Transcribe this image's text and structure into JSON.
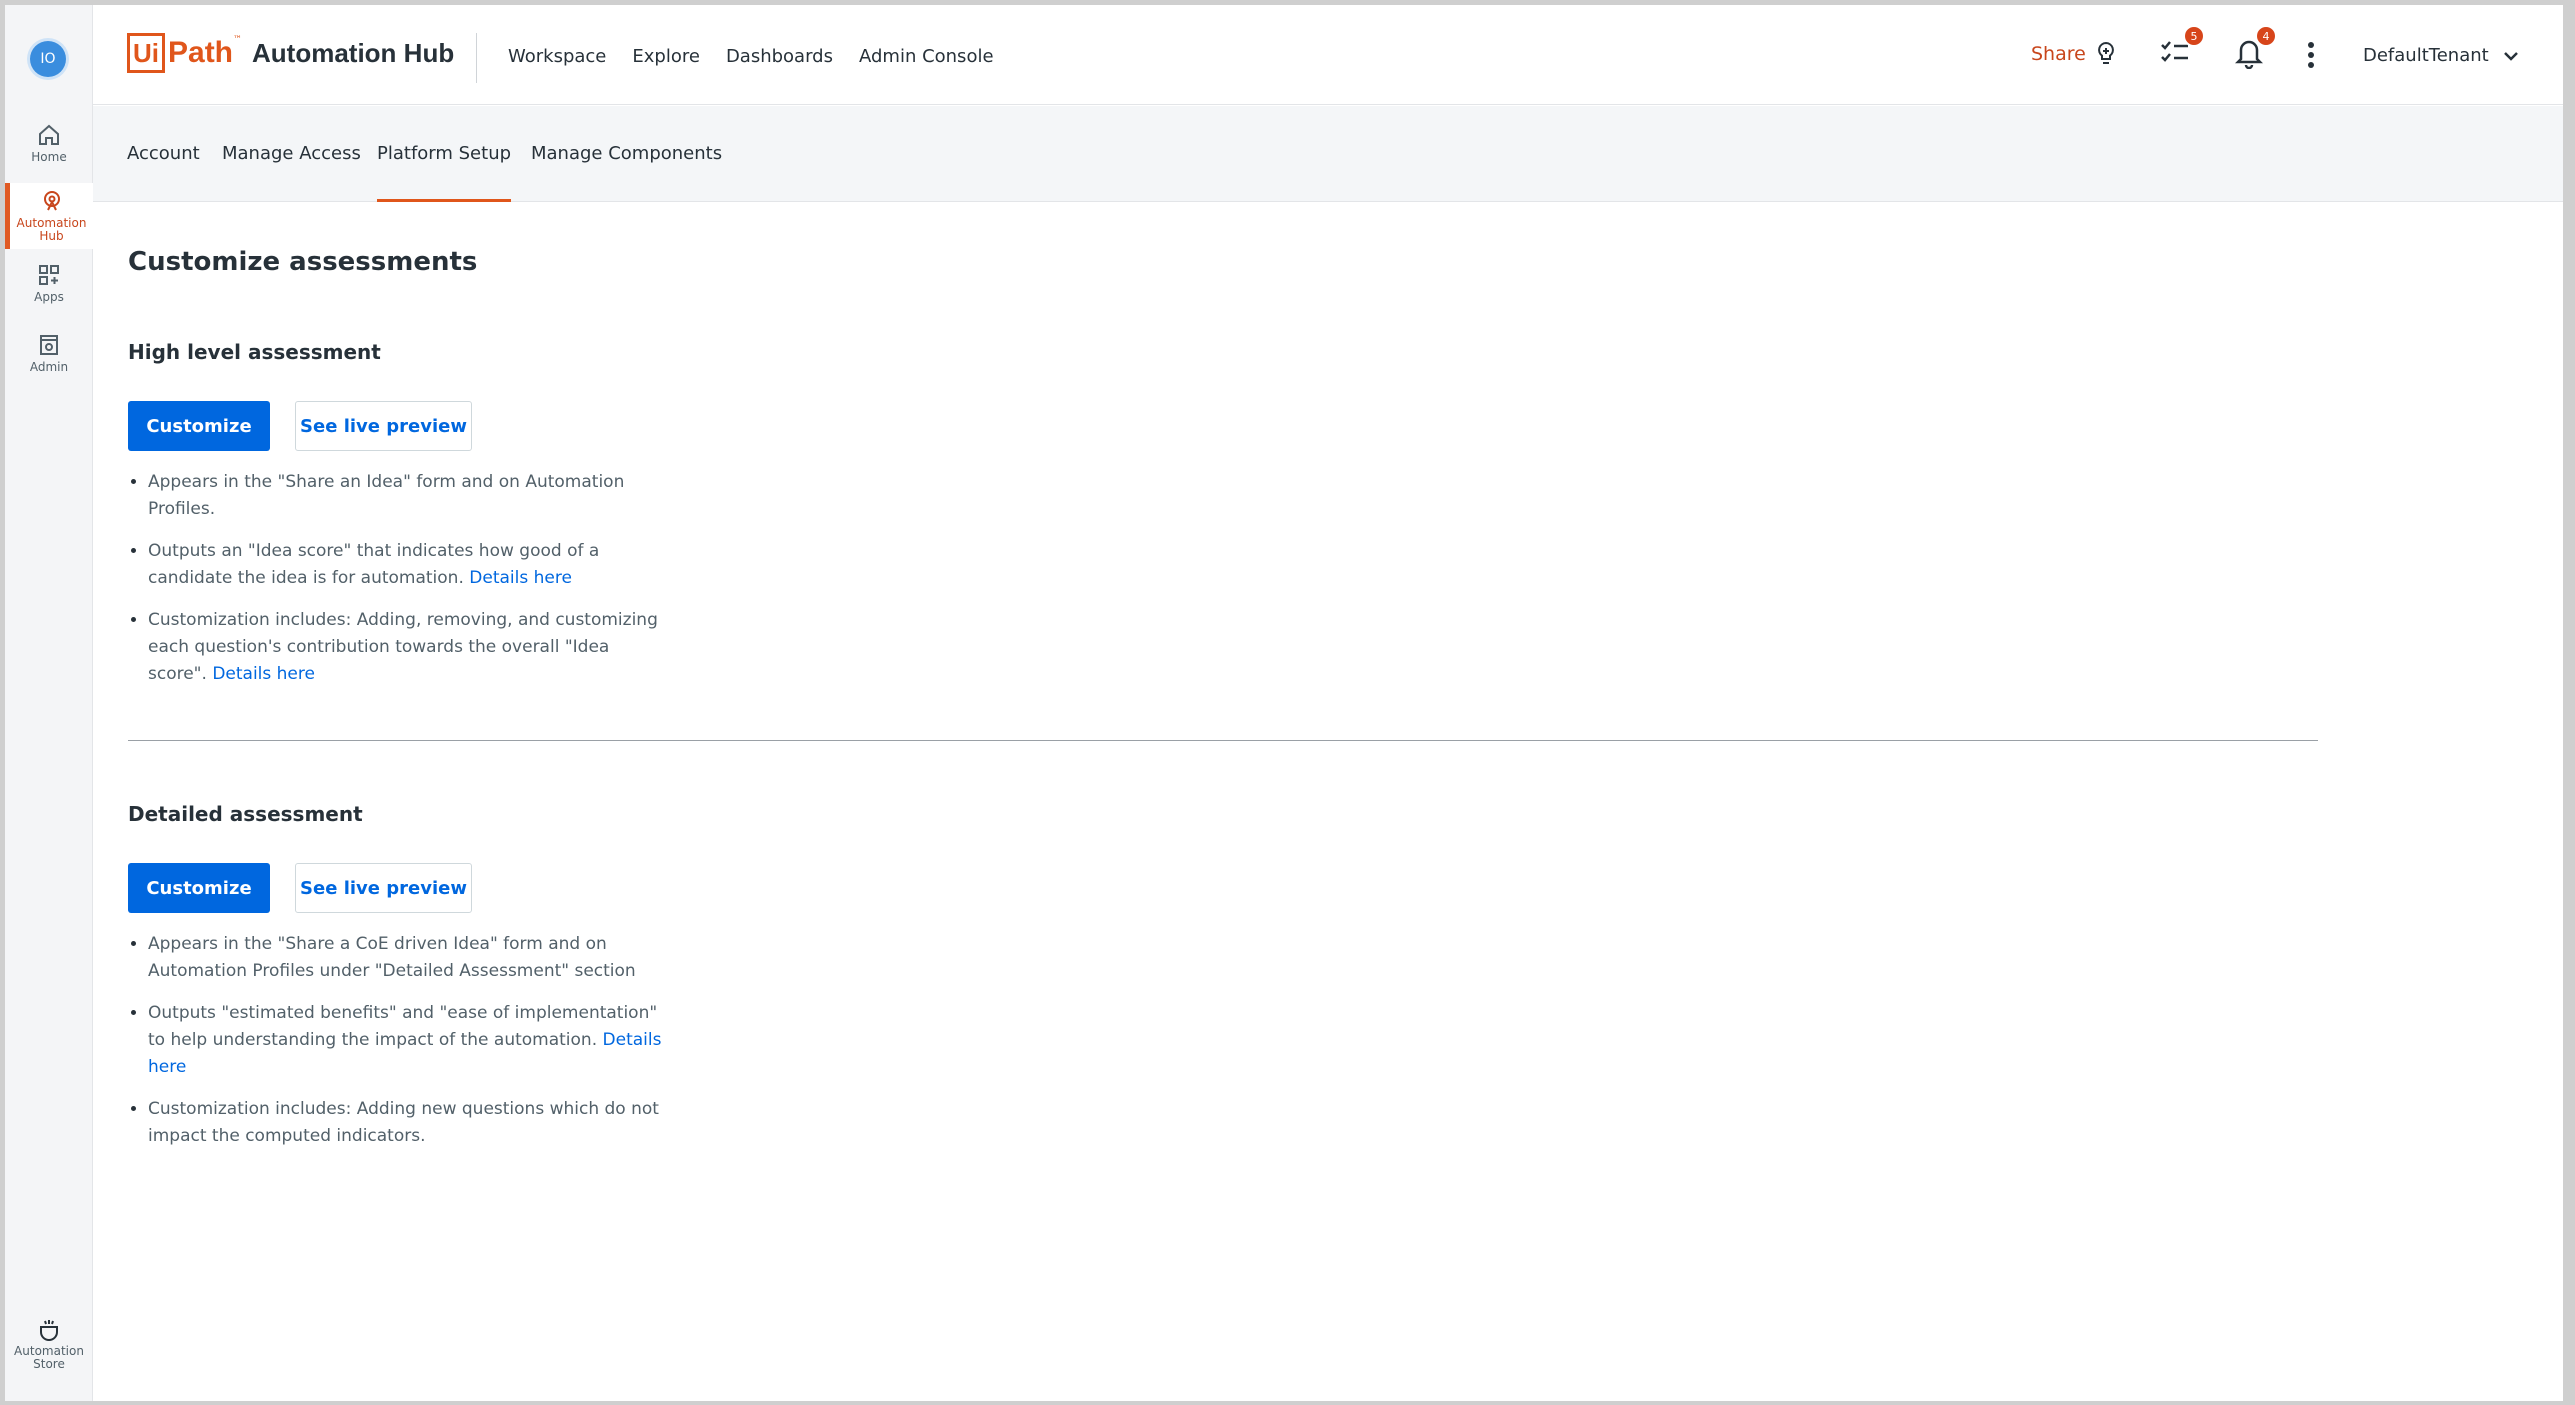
{
  "rail": {
    "avatar": "IO",
    "items": [
      {
        "label": "Home"
      },
      {
        "label": "Automation Hub"
      },
      {
        "label": "Apps"
      },
      {
        "label": "Admin"
      }
    ],
    "bottom_item": {
      "label": "Automation Store"
    }
  },
  "header": {
    "logo_ui": "Ui",
    "logo_path": "Path",
    "logo_tm": "™",
    "product": "Automation Hub",
    "nav": [
      "Workspace",
      "Explore",
      "Dashboards",
      "Admin Console"
    ],
    "share_label": "Share",
    "tasks_badge": "5",
    "notifications_badge": "4",
    "tenant": "DefaultTenant"
  },
  "subnav": {
    "tabs": [
      "Account",
      "Manage Access",
      "Platform Setup",
      "Manage Components"
    ],
    "active": "Platform Setup"
  },
  "main": {
    "title": "Customize assessments",
    "high_level": {
      "title": "High level assessment",
      "customize_label": "Customize",
      "preview_label": "See live preview",
      "bullets": [
        {
          "text": "Appears in the \"Share an Idea\" form and on Automation Profiles.",
          "link": ""
        },
        {
          "text": "Outputs an \"Idea score\" that indicates how good of a candidate the idea is for automation. ",
          "link": "Details here"
        },
        {
          "text": "Customization includes: Adding, removing, and customizing each question's contribution towards the overall \"Idea score\". ",
          "link": "Details here"
        }
      ]
    },
    "detailed": {
      "title": "Detailed assessment",
      "customize_label": "Customize",
      "preview_label": "See live preview",
      "bullets": [
        {
          "text": "Appears in the \"Share a CoE driven Idea\" form and on Automation Profiles under \"Detailed Assessment\" section",
          "link": ""
        },
        {
          "text": "Outputs \"estimated benefits\" and \"ease of implementation\" to help understanding the impact of the automation. ",
          "link": "Details here"
        },
        {
          "text": "Customization includes: Adding new questions which do not impact the computed indicators.",
          "link": ""
        }
      ]
    }
  },
  "colors": {
    "brand": "#e0561b",
    "primary": "#0067df",
    "badge": "#d7451a"
  }
}
